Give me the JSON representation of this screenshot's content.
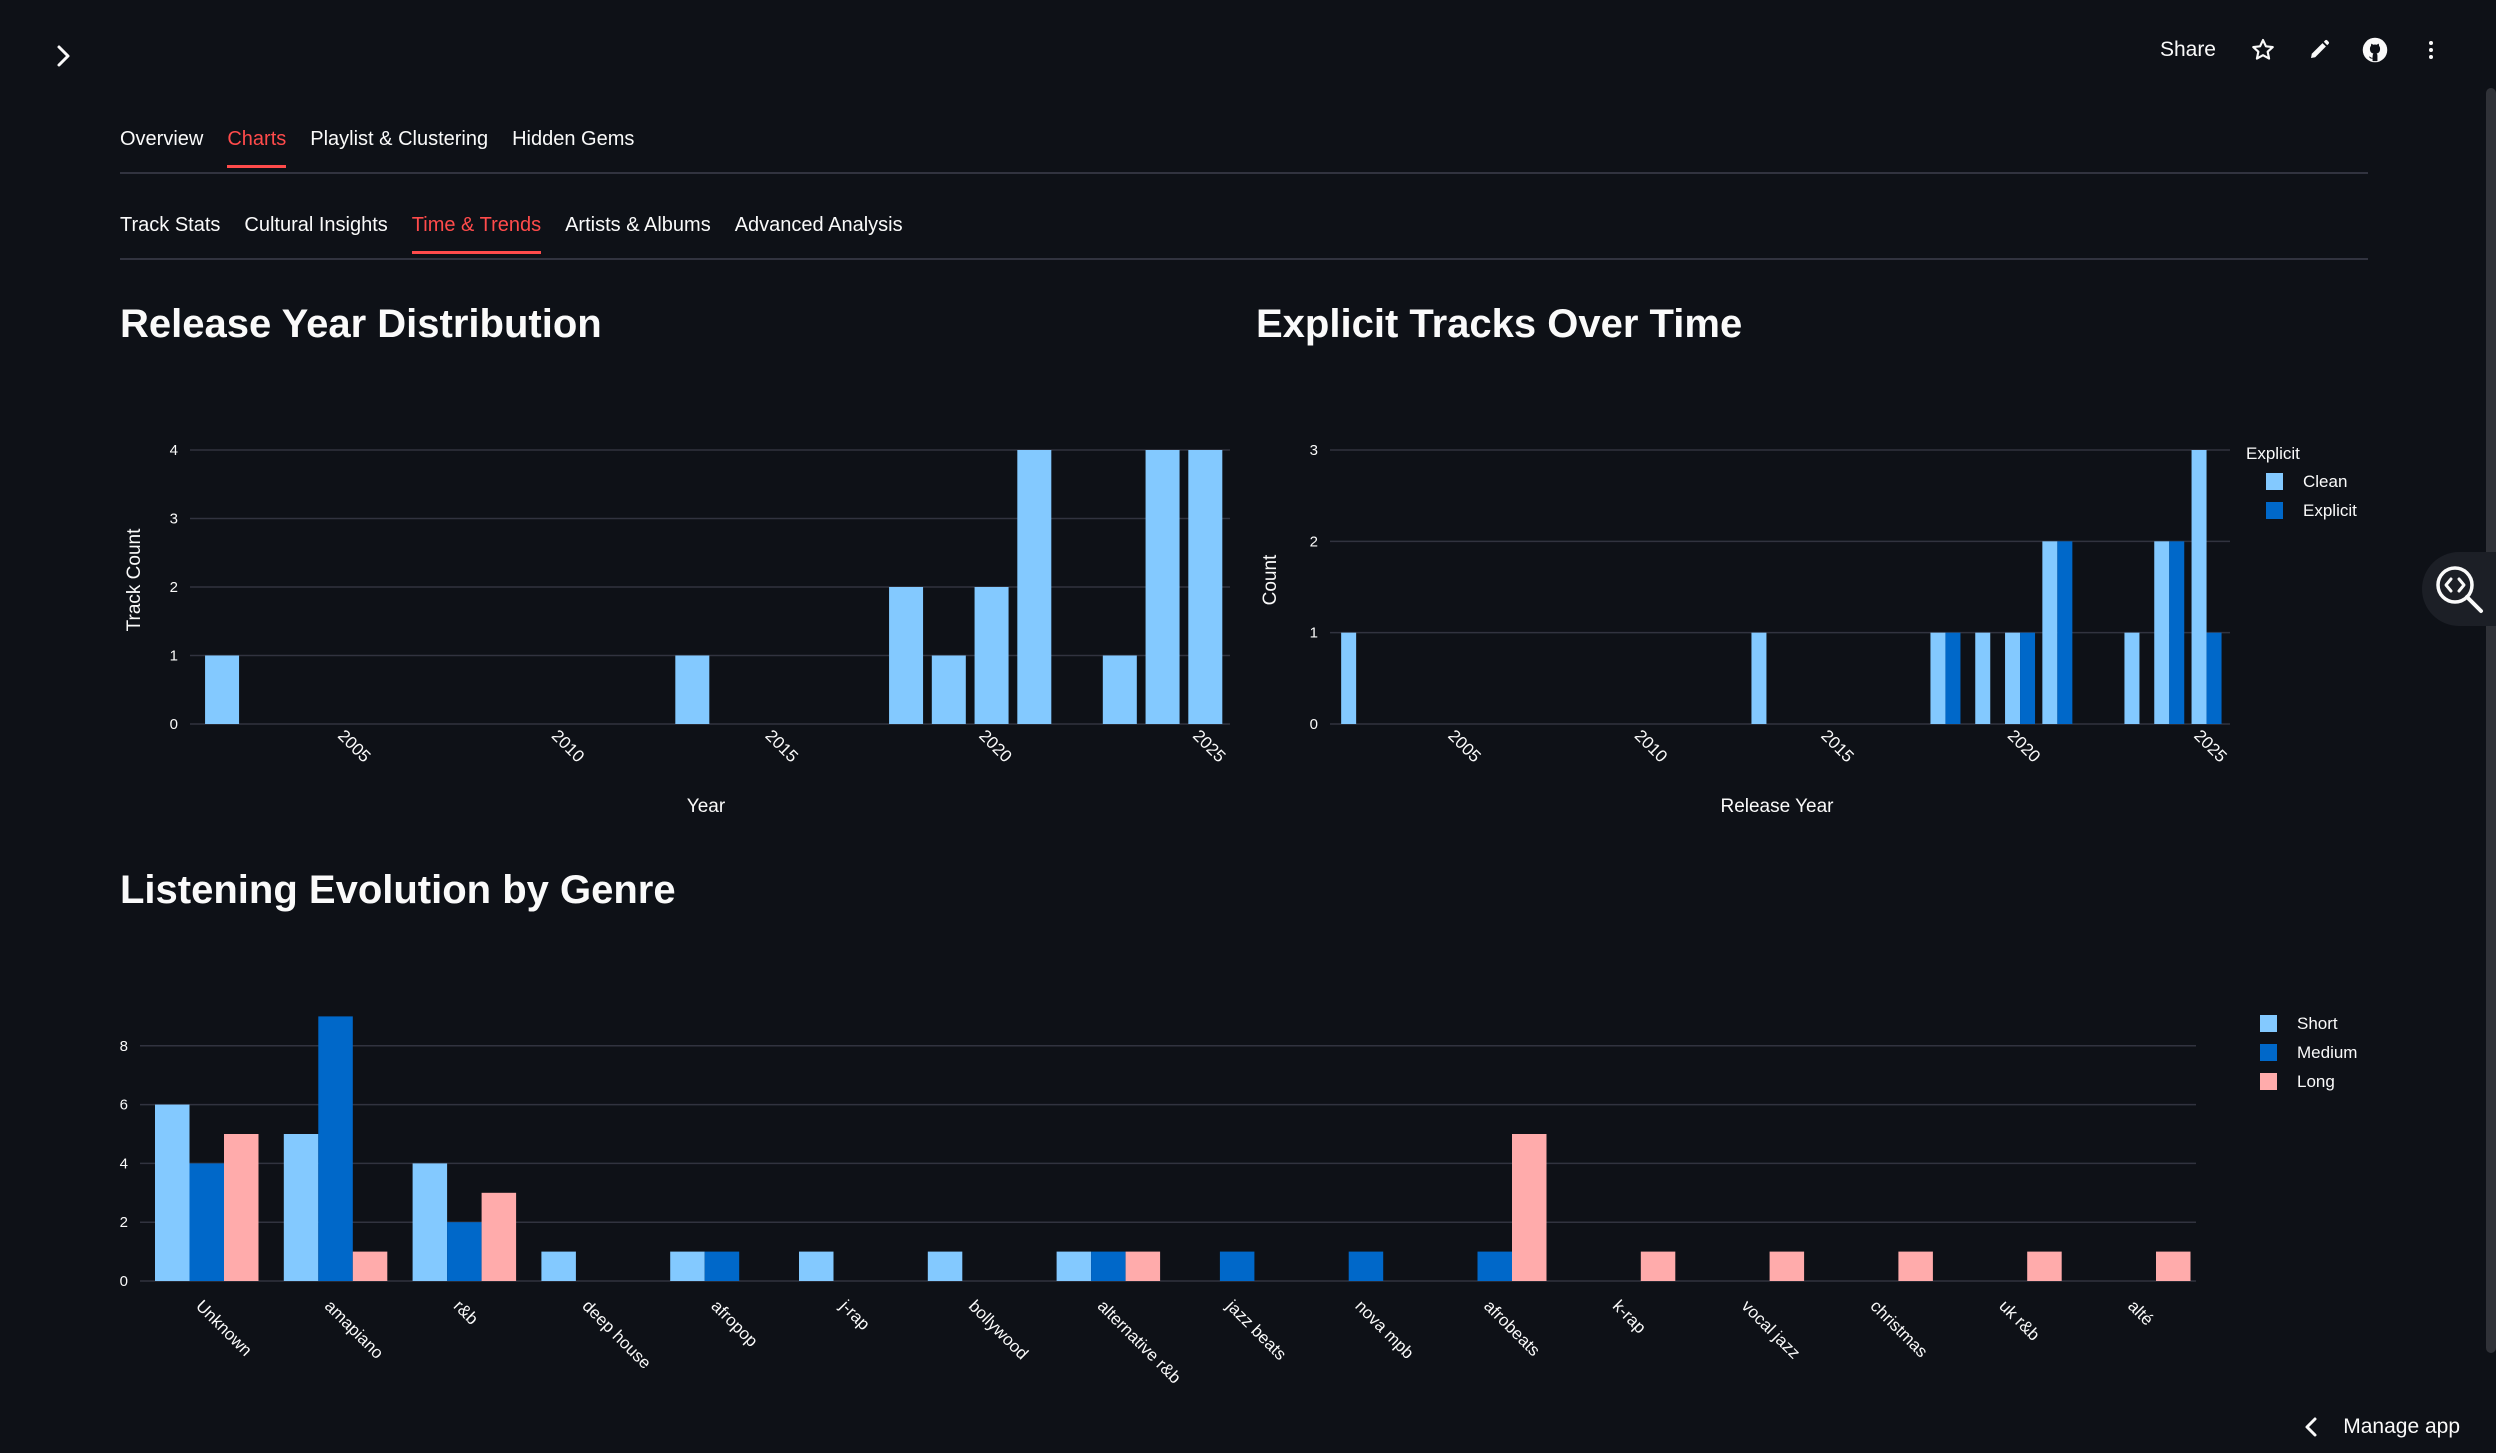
{
  "header": {
    "share_label": "Share",
    "icons": [
      "chevron-right-icon",
      "star-icon",
      "pencil-icon",
      "github-icon",
      "kebab-menu-icon"
    ]
  },
  "main_tabs": [
    {
      "label": "Overview",
      "active": false
    },
    {
      "label": "Charts",
      "active": true
    },
    {
      "label": "Playlist & Clustering",
      "active": false
    },
    {
      "label": "Hidden Gems",
      "active": false
    }
  ],
  "sub_tabs": [
    {
      "label": "Track Stats",
      "active": false
    },
    {
      "label": "Cultural Insights",
      "active": false
    },
    {
      "label": "Time & Trends",
      "active": true
    },
    {
      "label": "Artists & Albums",
      "active": false
    },
    {
      "label": "Advanced Analysis",
      "active": false
    }
  ],
  "colors": {
    "accent": "#ff4b4b",
    "background": "#0e1117",
    "light_blue": "#83c9ff",
    "dark_blue": "#0068c9",
    "pink": "#ffabab"
  },
  "chart_data": [
    {
      "type": "bar",
      "title": "Release Year Distribution",
      "xlabel": "Year",
      "ylabel": "Track Count",
      "x": [
        2002,
        2013,
        2018,
        2019,
        2020,
        2021,
        2023,
        2024,
        2025
      ],
      "values": [
        1,
        1,
        2,
        1,
        2,
        4,
        1,
        4,
        4
      ],
      "xticks": [
        "2005",
        "2010",
        "2015",
        "2020",
        "2025"
      ],
      "yticks": [
        "0",
        "1",
        "2",
        "3",
        "4"
      ],
      "ylim": [
        0,
        4
      ],
      "grid": true
    },
    {
      "type": "bar",
      "title": "Explicit Tracks Over Time",
      "xlabel": "Release Year",
      "ylabel": "Count",
      "legend_title": "Explicit",
      "legend_position": "right",
      "xticks": [
        "2005",
        "2010",
        "2015",
        "2020",
        "2025"
      ],
      "yticks": [
        "0",
        "1",
        "2",
        "3"
      ],
      "ylim": [
        0,
        3
      ],
      "grid": true,
      "series": [
        {
          "name": "Clean",
          "color": "#83c9ff",
          "points": [
            {
              "x": 2002,
              "y": 1
            },
            {
              "x": 2013,
              "y": 1
            },
            {
              "x": 2018,
              "y": 1
            },
            {
              "x": 2019,
              "y": 1
            },
            {
              "x": 2020,
              "y": 1
            },
            {
              "x": 2021,
              "y": 2
            },
            {
              "x": 2023,
              "y": 1
            },
            {
              "x": 2024,
              "y": 2
            },
            {
              "x": 2025,
              "y": 3
            }
          ]
        },
        {
          "name": "Explicit",
          "color": "#0068c9",
          "points": [
            {
              "x": 2018,
              "y": 1
            },
            {
              "x": 2020,
              "y": 1
            },
            {
              "x": 2021,
              "y": 2
            },
            {
              "x": 2024,
              "y": 2
            },
            {
              "x": 2025,
              "y": 1
            }
          ]
        }
      ]
    },
    {
      "type": "bar",
      "title": "Listening Evolution by Genre",
      "xlabel": "",
      "ylabel": "",
      "legend_position": "right",
      "categories": [
        "Unknown",
        "amapiano",
        "r&b",
        "deep house",
        "afropop",
        "j-rap",
        "bollywood",
        "alternative r&b",
        "jazz beats",
        "nova mpb",
        "afrobeats",
        "k-rap",
        "vocal jazz",
        "christmas",
        "uk r&b",
        "alté"
      ],
      "yticks": [
        "0",
        "2",
        "4",
        "6",
        "8"
      ],
      "ylim": [
        0,
        9
      ],
      "grid": true,
      "series": [
        {
          "name": "Short",
          "color": "#83c9ff",
          "values": [
            6,
            5,
            4,
            1,
            1,
            1,
            1,
            1,
            0,
            0,
            0,
            0,
            0,
            0,
            0,
            0
          ]
        },
        {
          "name": "Medium",
          "color": "#0068c9",
          "values": [
            4,
            9,
            2,
            0,
            1,
            0,
            0,
            1,
            1,
            1,
            1,
            0,
            0,
            0,
            0,
            0
          ]
        },
        {
          "name": "Long",
          "color": "#ffabab",
          "values": [
            5,
            1,
            3,
            0,
            0,
            0,
            0,
            1,
            0,
            0,
            5,
            1,
            1,
            1,
            1,
            1
          ]
        }
      ]
    }
  ],
  "footer": {
    "manage_app_label": "Manage app"
  }
}
